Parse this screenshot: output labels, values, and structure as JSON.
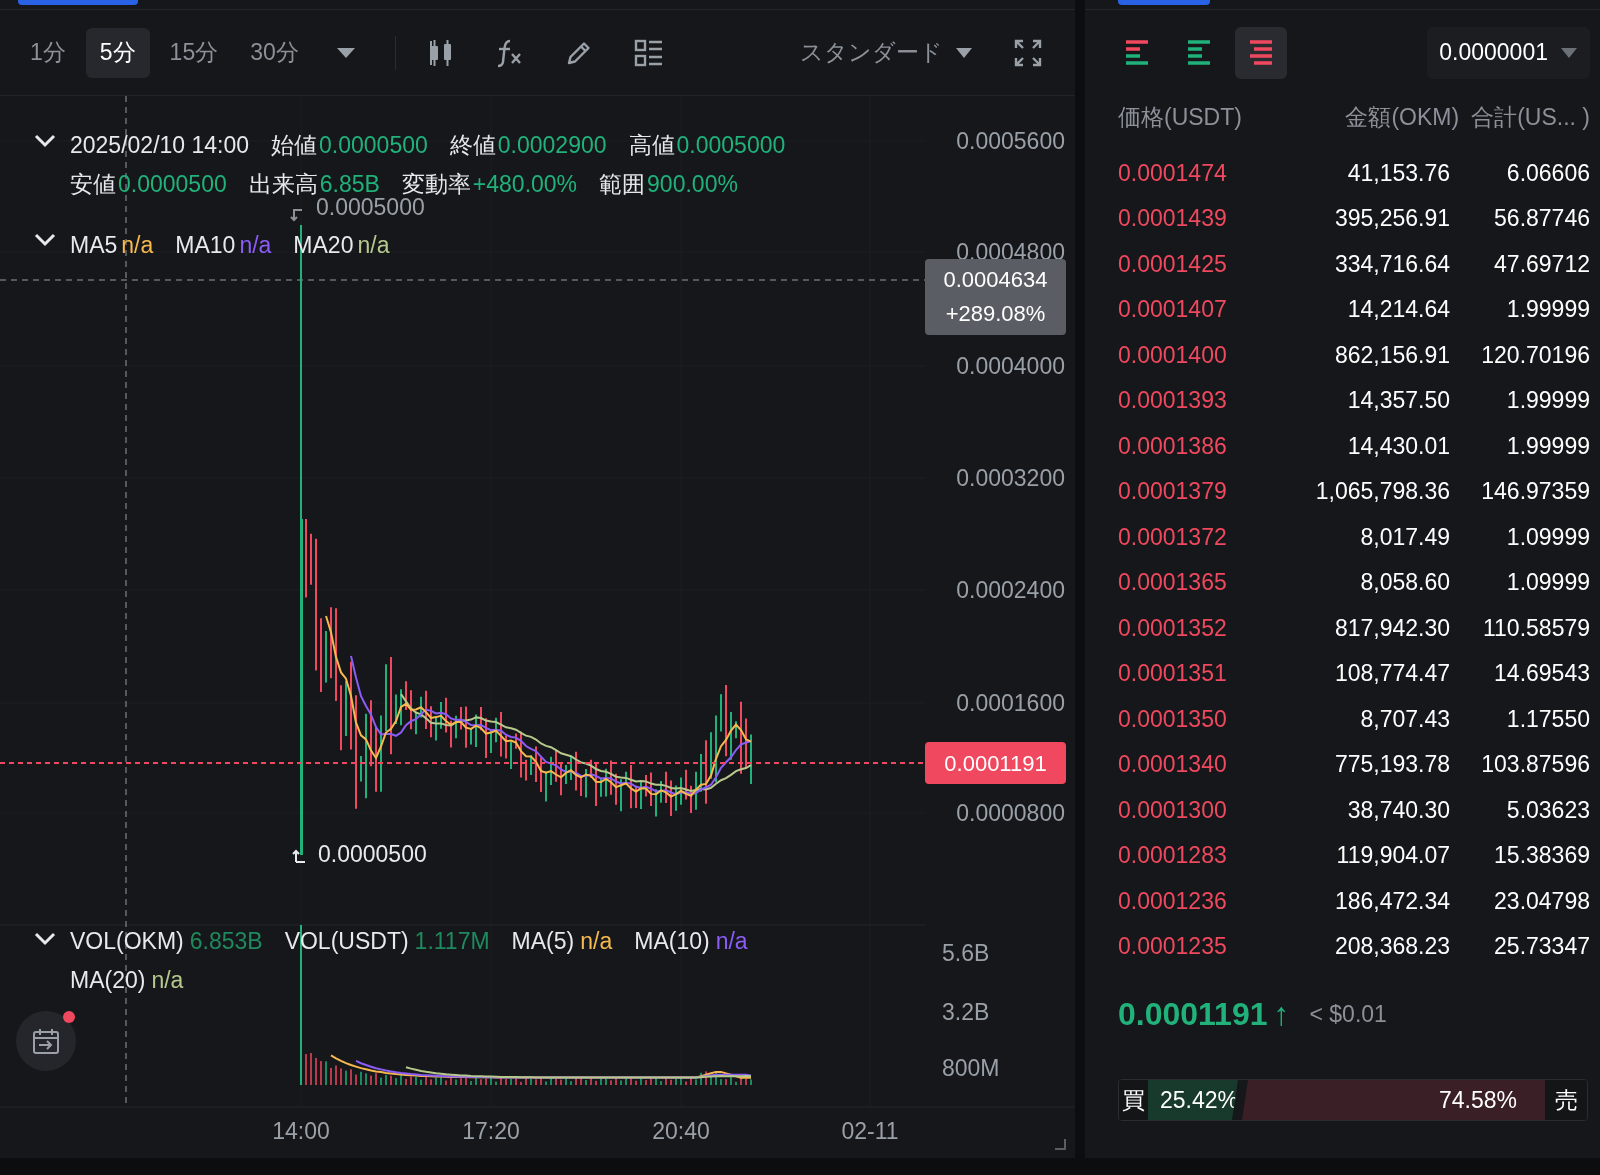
{
  "timeframe_tabs": [
    {
      "label": "1分",
      "selected": false
    },
    {
      "label": "5分",
      "selected": true
    },
    {
      "label": "15分",
      "selected": false
    },
    {
      "label": "30分",
      "selected": false
    }
  ],
  "chart_style": "スタンダード",
  "ohlc": {
    "date": "2025/02/10 14:00",
    "fields": [
      {
        "label": "始値",
        "value": "0.0000500"
      },
      {
        "label": "終値",
        "value": "0.0002900"
      },
      {
        "label": "高値",
        "value": "0.0005000"
      },
      {
        "label": "安値",
        "value": "0.0000500"
      },
      {
        "label": "出来高",
        "value": "6.85B"
      },
      {
        "label": "変動率",
        "value": "+480.00%"
      },
      {
        "label": "範囲",
        "value": "900.00%"
      }
    ]
  },
  "ma_legend": [
    {
      "label": "MA5",
      "value": "n/a",
      "color": "#f5b94f"
    },
    {
      "label": "MA10",
      "value": "n/a",
      "color": "#8b5cf6"
    },
    {
      "label": "MA20",
      "value": "n/a",
      "color": "#b6c98c"
    }
  ],
  "high_marker": "0.0005000",
  "low_marker": "0.0000500",
  "price_axis": [
    "0.0005600",
    "0.0004800",
    "0.0004000",
    "0.0003200",
    "0.0002400",
    "0.0001600",
    "0.0000800"
  ],
  "crosshair": {
    "price": "0.0004634",
    "change": "+289.08%"
  },
  "last_price_label": "0.0001191",
  "volume_legend": [
    {
      "label": "VOL(OKM)",
      "value": "6.853B",
      "color": "#1f8a5e"
    },
    {
      "label": "VOL(USDT)",
      "value": "1.117M",
      "color": "#1f8a5e"
    },
    {
      "label": "MA(5)",
      "value": "n/a",
      "color": "#f5b94f"
    },
    {
      "label": "MA(10)",
      "value": "n/a",
      "color": "#8b5cf6"
    },
    {
      "label": "MA(20)",
      "value": "n/a",
      "color": "#b6c98c"
    }
  ],
  "volume_axis": [
    "5.6B",
    "3.2B",
    "800M"
  ],
  "time_axis": [
    "14:00",
    "17:20",
    "20:40",
    "02-11"
  ],
  "order_book": {
    "view_modes": [
      {
        "kind": "both",
        "selected": false
      },
      {
        "kind": "bids",
        "selected": false
      },
      {
        "kind": "asks",
        "selected": true
      }
    ],
    "precision": "0.0000001",
    "columns": [
      "価格(USDT)",
      "金額(OKM)",
      "合計(US... )"
    ],
    "asks": [
      {
        "price": "0.0001474",
        "amount": "41,153.76",
        "total": "6.06606"
      },
      {
        "price": "0.0001439",
        "amount": "395,256.91",
        "total": "56.87746"
      },
      {
        "price": "0.0001425",
        "amount": "334,716.64",
        "total": "47.69712"
      },
      {
        "price": "0.0001407",
        "amount": "14,214.64",
        "total": "1.99999"
      },
      {
        "price": "0.0001400",
        "amount": "862,156.91",
        "total": "120.70196"
      },
      {
        "price": "0.0001393",
        "amount": "14,357.50",
        "total": "1.99999"
      },
      {
        "price": "0.0001386",
        "amount": "14,430.01",
        "total": "1.99999"
      },
      {
        "price": "0.0001379",
        "amount": "1,065,798.36",
        "total": "146.97359"
      },
      {
        "price": "0.0001372",
        "amount": "8,017.49",
        "total": "1.09999"
      },
      {
        "price": "0.0001365",
        "amount": "8,058.60",
        "total": "1.09999"
      },
      {
        "price": "0.0001352",
        "amount": "817,942.30",
        "total": "110.58579"
      },
      {
        "price": "0.0001351",
        "amount": "108,774.47",
        "total": "14.69543"
      },
      {
        "price": "0.0001350",
        "amount": "8,707.43",
        "total": "1.17550"
      },
      {
        "price": "0.0001340",
        "amount": "775,193.78",
        "total": "103.87596"
      },
      {
        "price": "0.0001300",
        "amount": "38,740.30",
        "total": "5.03623"
      },
      {
        "price": "0.0001283",
        "amount": "119,904.07",
        "total": "15.38369"
      },
      {
        "price": "0.0001236",
        "amount": "186,472.34",
        "total": "23.04798"
      },
      {
        "price": "0.0001235",
        "amount": "208,368.23",
        "total": "25.73347"
      }
    ],
    "last_price": "0.0001191",
    "direction_glyph": "↑",
    "usd_price": "< $0.01",
    "buy": {
      "label": "買",
      "percent": "25.42%",
      "level": 0.2542
    },
    "sell": {
      "label": "売",
      "percent": "74.58%"
    }
  }
}
